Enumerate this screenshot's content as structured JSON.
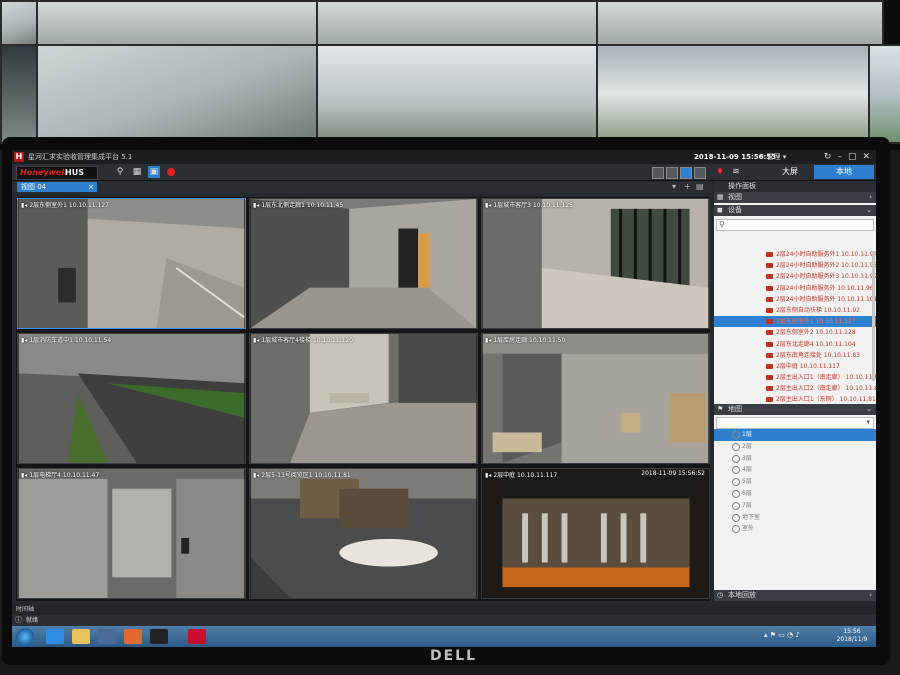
{
  "app": {
    "title": "星河汇求实验收管理集成平台 5.1",
    "datetime": "2018-11-09 15:56:53",
    "manage_label": "管理",
    "brand_hw": "Honeywell",
    "brand_hus": "HUS",
    "big_screen_label": "大屏",
    "local_label": "本地"
  },
  "view_tab": {
    "label": "视图 04"
  },
  "cameras": [
    {
      "label": "2层东侧室外1  10.10.11.127",
      "scene": "outdoor-courtyard"
    },
    {
      "label": "1层东北侧走廊1  10.10.11.45",
      "scene": "corridor"
    },
    {
      "label": "1层城市客厅3   10.10.11.125",
      "scene": "hall"
    },
    {
      "label": "1层消防车道中1  10.10.11.54",
      "scene": "driveway"
    },
    {
      "label": "1层城市客厅4楼梯  10.10.11.120",
      "scene": "stair"
    },
    {
      "label": "1层库房走廊    10.10.11.50",
      "scene": "storage"
    },
    {
      "label": "1层电梯厅4  10.10.11.47",
      "scene": "elevator"
    },
    {
      "label": "2层5-13号阅览区1  10.10.11.81",
      "scene": "library"
    },
    {
      "label": "2层中庭    10.10.11.117",
      "scene": "atrium",
      "timestamp": "2018-11-09 15:56:52"
    }
  ],
  "panel": {
    "header": "操作面板",
    "views_label": "视图",
    "devices_label": "设备",
    "devices": [
      "2层24小时自助服务外1  10.10.11.94",
      "2层24小时自助服务外2  10.10.11.95",
      "2层24小时自助服务外3  10.10.11.99",
      "2层24小时自助服务外  10.10.11.96",
      "2层24小时自助服务外  10.10.11.101",
      "2层东侧自动扶梯   10.10.11.92",
      "2层东侧室外1    10.10.11.127",
      "2层东侧室外2    10.10.11.128",
      "2层东北走廊4    10.10.11.104",
      "2层东南角连接处   10.10.11.83",
      "2层中庭      10.10.11.117",
      "2层主出入口1（南走廊） 10.10.11.84",
      "2层主出入口2（南走廊） 10.10.11.85",
      "2层主出入口1（东侧） 10.10.11.81"
    ],
    "selected_device": 6,
    "map_label": "地图",
    "floors": [
      "1层",
      "2层",
      "3层",
      "4层",
      "5层",
      "6层",
      "7层",
      "地下室",
      "室外"
    ],
    "selected_floor": 0,
    "playback_label": "本地回放"
  },
  "time_axis_label": "时间轴",
  "status_text": "就绪",
  "taskbar": {
    "time": "15:56",
    "date": "2018/11/9"
  },
  "monitor_brand": "DELL"
}
